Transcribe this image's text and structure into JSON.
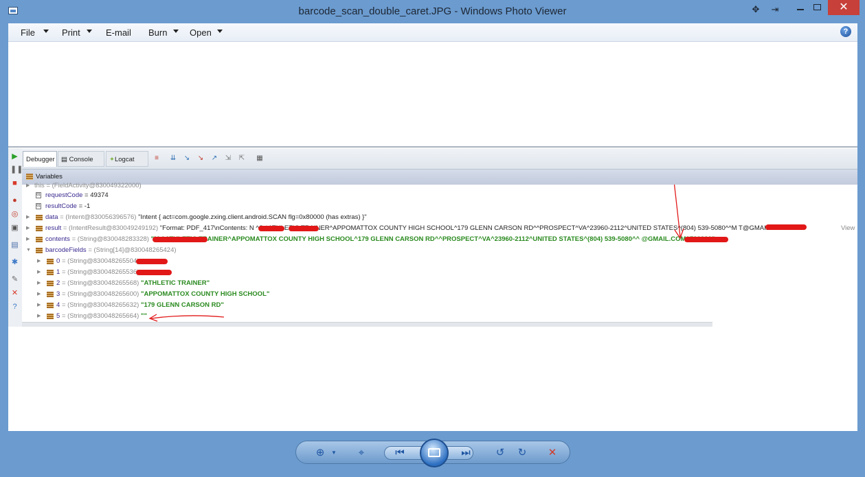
{
  "window": {
    "title": "barcode_scan_double_caret.JPG - Windows Photo Viewer",
    "close_glyph": "✕"
  },
  "menu": {
    "items": [
      "File",
      "Print",
      "E-mail",
      "Burn",
      "Open"
    ],
    "help": "?"
  },
  "debugger": {
    "tabs": [
      "Debugger",
      "Console",
      "Logcat"
    ],
    "console_suffix": "→°",
    "logcat_suffix": "→°",
    "variables_label": "Variables",
    "rows": {
      "this_name": "this",
      "this_type": "= (FieldActivity@830049322000)",
      "requestCode_name": "requestCode",
      "requestCode_value": "= 49374",
      "resultCode_name": "resultCode",
      "resultCode_value": "= -1",
      "data_name": "data",
      "data_type": "= (Intent@830056396576)",
      "data_value": "\"Intent { act=com.google.zxing.client.android.SCAN flg=0x80000 (has extras) }\"",
      "result_name": "result",
      "result_type": "= (IntentResult@830049249192)",
      "result_value": "\"Format: PDF_417\\nContents: N          ^S         ^ATHLETIC TRAINER^APPOMATTOX COUNTY HIGH SCHOOL^179 GLENN CARSON RD^^PROSPECT^VA^23960-2112^UNITED STATES^(804) 539-5080^^M                  T@GMAIL.CO...",
      "result_view": "View",
      "contents_name": "contents",
      "contents_type": "= (String@830048283328)",
      "contents_value": "\"M                       ^ATHLETIC TRAINER^APPOMATTOX COUNTY HIGH SCHOOL^179 GLENN CARSON RD^^PROSPECT^VA^23960-2112^UNITED STATES^(804) 539-5080^^                  @GMAIL.COM^72233^\"",
      "barcodeFields_name": "barcodeFields",
      "barcodeFields_type": "= (String[14]@830048265424)",
      "f0_name": "0",
      "f0_type": "= (String@830048265504)",
      "f1_name": "1",
      "f1_type": "= (String@830048265536)",
      "f2_name": "2",
      "f2_type": "= (String@830048265568)",
      "f2_value": "\"ATHLETIC TRAINER\"",
      "f3_name": "3",
      "f3_type": "= (String@830048265600)",
      "f3_value": "\"APPOMATTOX COUNTY HIGH SCHOOL\"",
      "f4_name": "4",
      "f4_type": "= (String@830048265632)",
      "f4_value": "\"179 GLENN CARSON RD\"",
      "f5_name": "5",
      "f5_type": "= (String@830048265664)",
      "f5_value": "\"\""
    }
  },
  "colors": {
    "scribble": "#e21818",
    "string_value": "#2a8a1f",
    "close_button": "#c7403a"
  }
}
